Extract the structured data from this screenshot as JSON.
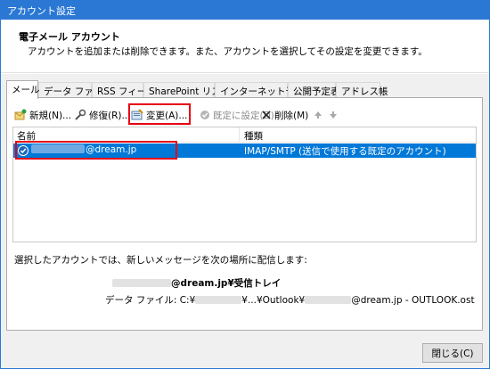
{
  "window": {
    "title": "アカウント設定"
  },
  "header": {
    "title": "電子メール アカウント",
    "description": "アカウントを追加または削除できます。また、アカウントを選択してその設定を変更できます。"
  },
  "tabs": [
    {
      "label": "メール",
      "active": true
    },
    {
      "label": "データ ファイル"
    },
    {
      "label": "RSS フィード"
    },
    {
      "label": "SharePoint リスト"
    },
    {
      "label": "インターネット予定表"
    },
    {
      "label": "公開予定表"
    },
    {
      "label": "アドレス帳"
    }
  ],
  "toolbar": {
    "new_label": "新規(N)...",
    "repair_label": "修復(R)...",
    "change_label": "変更(A)...",
    "default_label": "既定に設定(D)",
    "delete_label": "削除(M)"
  },
  "list": {
    "col_name": "名前",
    "col_type": "種類",
    "rows": [
      {
        "email": "@dream.jp",
        "type": "IMAP/SMTP (送信で使用する既定のアカウント)",
        "selected": true
      }
    ]
  },
  "info": {
    "deliver_text": "選択したアカウントでは、新しいメッセージを次の場所に配信します:",
    "deliver_location": "@dream.jp¥受信トレイ",
    "datafile_label": "データ ファイル: C:¥",
    "datafile_mid": "¥...¥Outlook¥",
    "datafile_end": "@dream.jp - OUTLOOK.ost"
  },
  "buttons": {
    "close_label": "閉じる(C)"
  },
  "colors": {
    "accent": "#2b78d4",
    "selection": "#0078d7",
    "highlight": "#e60012"
  }
}
